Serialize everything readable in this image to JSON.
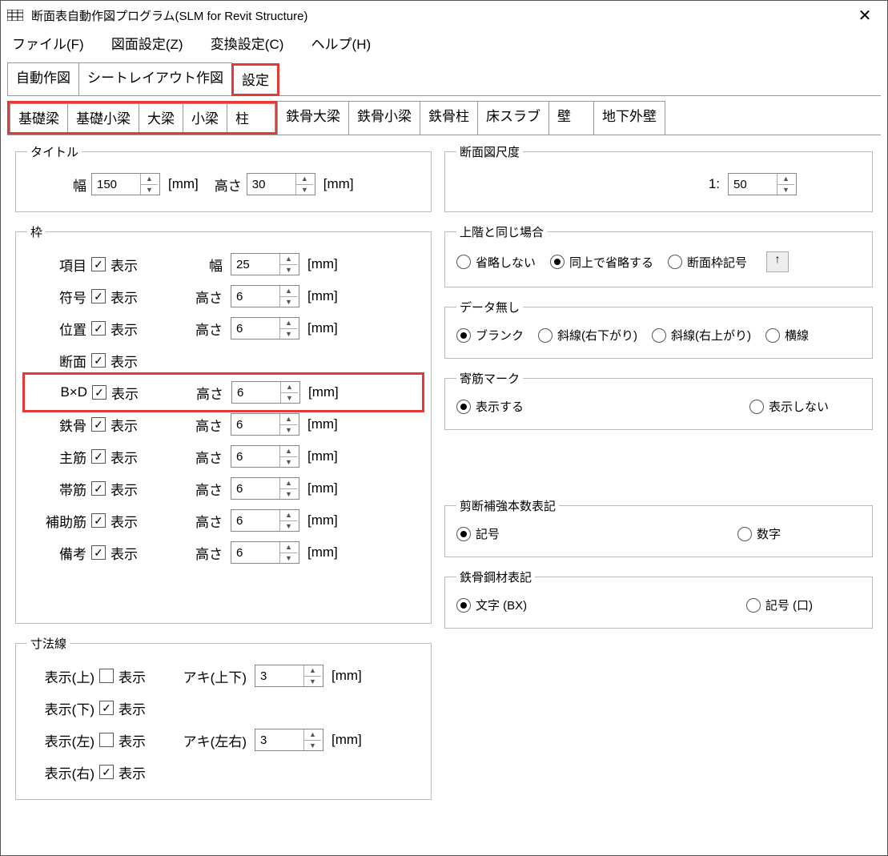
{
  "window": {
    "title": "断面表自動作図プログラム(SLM for Revit Structure)"
  },
  "menu": {
    "file": "ファイル(F)",
    "drawing": "図面設定(Z)",
    "convert": "変換設定(C)",
    "help": "ヘルプ(H)"
  },
  "tabs1": [
    "自動作図",
    "シートレイアウト作図",
    "設定"
  ],
  "tabs2": [
    "基礎梁",
    "基礎小梁",
    "大梁",
    "小梁",
    "柱",
    "鉄骨大梁",
    "鉄骨小梁",
    "鉄骨柱",
    "床スラブ",
    "壁",
    "地下外壁"
  ],
  "groups": {
    "title": {
      "legend": "タイトル",
      "width_label": "幅",
      "width_val": "150",
      "height_label": "高さ",
      "height_val": "30",
      "unit": "[mm]"
    },
    "frame": {
      "legend": "枠",
      "show_label": "表示",
      "width_label": "幅",
      "height_label": "高さ",
      "unit": "[mm]",
      "rows": [
        {
          "key": "item",
          "label": "項目",
          "checked": true,
          "dim": "width",
          "val": "25"
        },
        {
          "key": "symbol",
          "label": "符号",
          "checked": true,
          "dim": "height",
          "val": "6"
        },
        {
          "key": "position",
          "label": "位置",
          "checked": true,
          "dim": "height",
          "val": "6"
        },
        {
          "key": "section",
          "label": "断面",
          "checked": true,
          "dim": null
        },
        {
          "key": "bxd",
          "label": "B×D",
          "checked": true,
          "dim": "height",
          "val": "6",
          "highlight": true
        },
        {
          "key": "steel",
          "label": "鉄骨",
          "checked": true,
          "dim": "height",
          "val": "6"
        },
        {
          "key": "main",
          "label": "主筋",
          "checked": true,
          "dim": "height",
          "val": "6"
        },
        {
          "key": "hoop",
          "label": "帯筋",
          "checked": true,
          "dim": "height",
          "val": "6"
        },
        {
          "key": "aux",
          "label": "補助筋",
          "checked": true,
          "dim": "height",
          "val": "6"
        },
        {
          "key": "remark",
          "label": "備考",
          "checked": true,
          "dim": "height",
          "val": "6"
        }
      ]
    },
    "dimline": {
      "legend": "寸法線",
      "show_label": "表示",
      "aki_tb": "アキ(上下)",
      "aki_tb_val": "3",
      "aki_lr": "アキ(左右)",
      "aki_lr_val": "3",
      "unit": "[mm]",
      "rows": [
        {
          "key": "top",
          "label": "表示(上)",
          "checked": false
        },
        {
          "key": "bottom",
          "label": "表示(下)",
          "checked": true
        },
        {
          "key": "left",
          "label": "表示(左)",
          "checked": false
        },
        {
          "key": "right",
          "label": "表示(右)",
          "checked": true
        }
      ]
    },
    "scale": {
      "legend": "断面図尺度",
      "prefix": "1:",
      "val": "50"
    },
    "sameupper": {
      "legend": "上階と同じ場合",
      "opts": [
        "省略しない",
        "同上で省略する",
        "断面枠記号"
      ],
      "sel": 1,
      "btn": "↑"
    },
    "nodata": {
      "legend": "データ無し",
      "opts": [
        "ブランク",
        "斜線(右下がり)",
        "斜線(右上がり)",
        "横線"
      ],
      "sel": 0
    },
    "closemark": {
      "legend": "寄筋マーク",
      "opts": [
        "表示する",
        "表示しない"
      ],
      "sel": 0
    },
    "shear": {
      "legend": "剪断補強本数表記",
      "opts": [
        "記号",
        "数字"
      ],
      "sel": 0
    },
    "steelmat": {
      "legend": "鉄骨鋼材表記",
      "opts": [
        "文字 (BX)",
        "記号 (口)"
      ],
      "sel": 0
    }
  }
}
